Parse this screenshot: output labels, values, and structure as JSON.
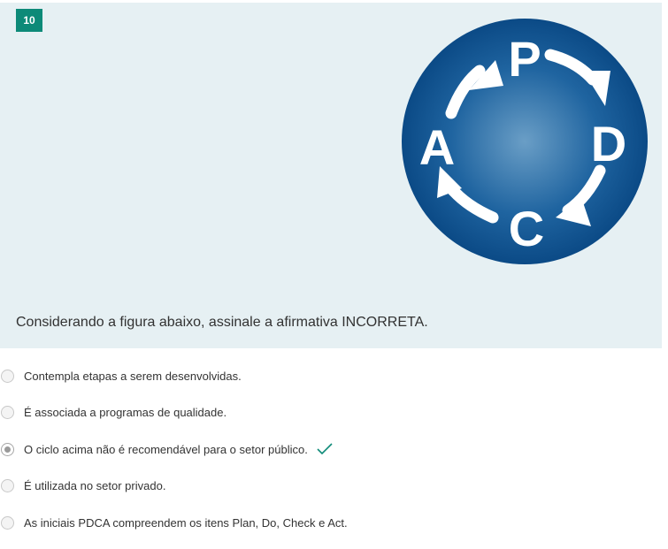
{
  "question": {
    "number": "10",
    "text": "Considerando a figura abaixo, assinale a afirmativa INCORRETA."
  },
  "figure": {
    "letters": {
      "top": "P",
      "right": "D",
      "bottom": "C",
      "left": "A"
    },
    "colors": {
      "circle_outer": "#0b4a86",
      "circle_inner": "#6a9ec6",
      "letters": "#ffffff"
    }
  },
  "options": [
    {
      "label": "Contempla etapas a serem desenvolvidas.",
      "selected": false
    },
    {
      "label": "É associada a programas de qualidade.",
      "selected": false
    },
    {
      "label": "O ciclo acima não é recomendável para o setor público.",
      "selected": true,
      "correct_mark": "check-icon"
    },
    {
      "label": "É utilizada no setor privado.",
      "selected": false
    },
    {
      "label": "As iniciais PDCA compreendem os itens Plan, Do, Check e Act.",
      "selected": false
    }
  ],
  "colors": {
    "badge": "#0d8a78",
    "panel": "#e6f0f3",
    "check": "#0d8a78"
  }
}
